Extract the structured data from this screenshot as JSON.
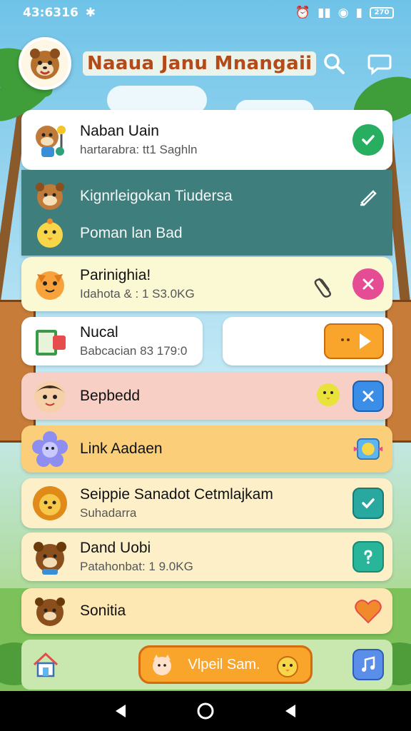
{
  "status_bar": {
    "time": "43:6316",
    "battery": "270"
  },
  "header": {
    "title": "Naaua Janu Mnangaii",
    "avatar_icon": "raccoon-avatar"
  },
  "rows": [
    {
      "title": "Naban Uain",
      "subtitle": "hartarabra: tt1 Saghln",
      "action": "check-circle-icon",
      "accent": "#27ae60"
    },
    {
      "title": "Kignrleigokan Tiudersa",
      "action": "edit-icon",
      "accent": "#ffffff"
    },
    {
      "title": "Poman lan Bad"
    },
    {
      "title": "Parinighia!",
      "subtitle": "Idahota & : 1 S3.0KG",
      "action": "close-circle-icon",
      "accent": "#e64c94"
    },
    {
      "title": "Nucal",
      "subtitle": "Babcacian 83 179:0"
    },
    {
      "title": "Bepbedd",
      "action": "close-square-icon",
      "accent": "#3b8ee8"
    },
    {
      "title": "Link Aadaen",
      "action": "star-badge-icon"
    },
    {
      "title": "Seippie Sanadot Cetmlajkam",
      "subtitle": "Suhadarra",
      "action": "check-square-icon",
      "accent": "#28a89e"
    },
    {
      "title": "Dand Uobi",
      "subtitle": "Patahonbat: 1 9.0KG",
      "action": "question-square-icon",
      "accent": "#28b59a"
    },
    {
      "title": "Sonitia",
      "action": "heart-icon",
      "accent": "#f08a2b"
    }
  ],
  "bottom_bar": {
    "cta_label": "Vlpeil Sam."
  },
  "colors": {
    "title": "#b44a17",
    "sky": "#6fc3e8",
    "cta": "#f9a52b"
  }
}
